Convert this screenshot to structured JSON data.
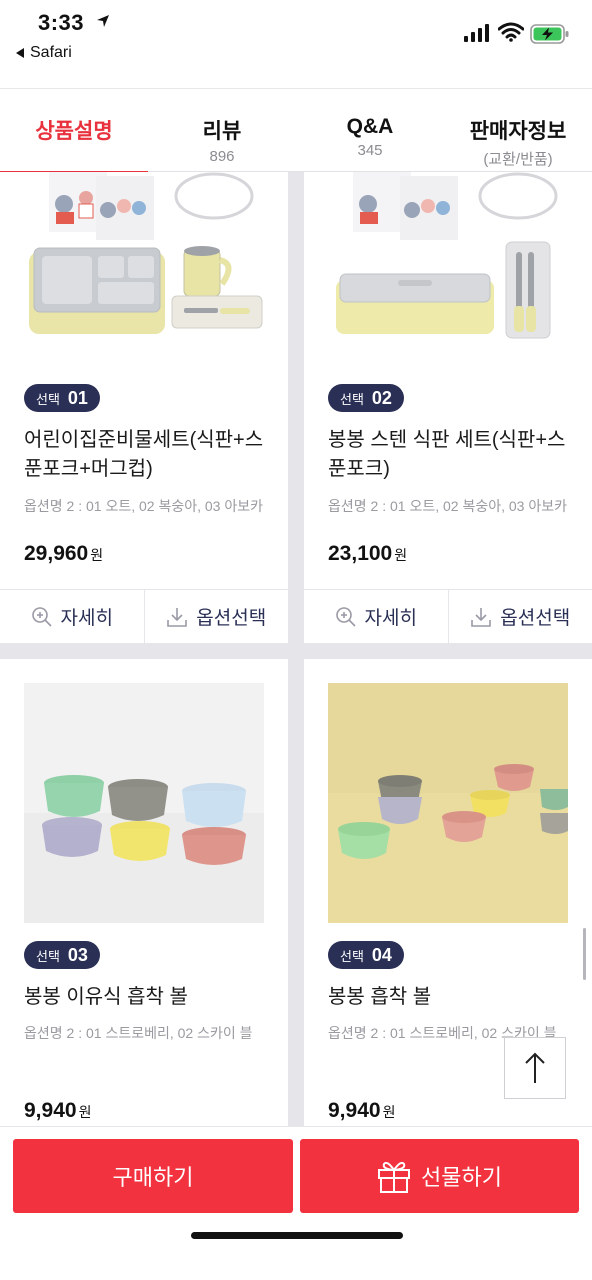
{
  "status": {
    "time": "3:33",
    "back_app": "Safari"
  },
  "tabs": [
    {
      "label": "상품설명",
      "sub": ""
    },
    {
      "label": "리뷰",
      "sub": "896"
    },
    {
      "label": "Q&A",
      "sub": "345"
    },
    {
      "label": "판매자정보",
      "sub": "(교환/반품)"
    }
  ],
  "products": [
    {
      "badge_word": "선택",
      "badge_num": "01",
      "name": "어린이집준비물세트(식판+스푼포크+머그컵)",
      "option": "옵션명 2 : 01 오트, 02 복숭아, 03 아보카",
      "price": "29,960",
      "won": "원"
    },
    {
      "badge_word": "선택",
      "badge_num": "02",
      "name": "봉봉 스텐 식판 세트(식판+스푼포크)",
      "option": "옵션명 2 : 01 오트, 02 복숭아, 03 아보카",
      "price": "23,100",
      "won": "원"
    },
    {
      "badge_word": "선택",
      "badge_num": "03",
      "name": "봉봉 이유식 흡착 볼",
      "option": "옵션명 2 : 01 스트로베리, 02 스카이 블",
      "price": "9,940",
      "won": "원"
    },
    {
      "badge_word": "선택",
      "badge_num": "04",
      "name": "봉봉 흡착 볼",
      "option": "옵션명 2 : 01 스트로베리, 02 스카이 블",
      "price": "9,940",
      "won": "원"
    }
  ],
  "actions": {
    "detail": "자세히",
    "option_select": "옵션선택"
  },
  "bottom": {
    "buy": "구매하기",
    "gift": "선물하기"
  },
  "colors": {
    "accent": "#f2333f",
    "badge": "#2a2f55",
    "tab_active": "#e8313c"
  }
}
